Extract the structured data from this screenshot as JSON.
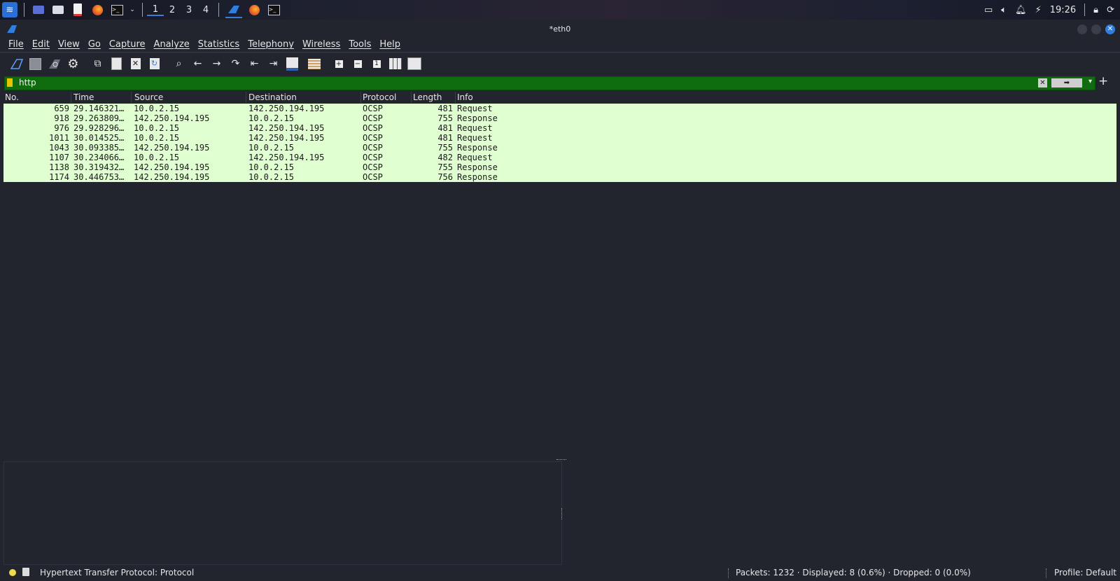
{
  "taskbar": {
    "workspaces": [
      "1",
      "2",
      "3",
      "4"
    ],
    "active_workspace": 0,
    "clock": "19:26"
  },
  "window": {
    "title": "*eth0"
  },
  "menu": [
    "File",
    "Edit",
    "View",
    "Go",
    "Capture",
    "Analyze",
    "Statistics",
    "Telephony",
    "Wireless",
    "Tools",
    "Help"
  ],
  "filter": {
    "value": "http",
    "color": "#0e6b0e"
  },
  "packet_list": {
    "columns": [
      "No.",
      "Time",
      "Source",
      "Destination",
      "Protocol",
      "Length",
      "Info"
    ],
    "row_color": "#e0ffd0",
    "rows": [
      [
        "659",
        "29.146321…",
        "10.0.2.15",
        "142.250.194.195",
        "OCSP",
        "481",
        "Request"
      ],
      [
        "918",
        "29.263809…",
        "142.250.194.195",
        "10.0.2.15",
        "OCSP",
        "755",
        "Response"
      ],
      [
        "976",
        "29.928296…",
        "10.0.2.15",
        "142.250.194.195",
        "OCSP",
        "481",
        "Request"
      ],
      [
        "1011",
        "30.014525…",
        "10.0.2.15",
        "142.250.194.195",
        "OCSP",
        "481",
        "Request"
      ],
      [
        "1043",
        "30.093385…",
        "142.250.194.195",
        "10.0.2.15",
        "OCSP",
        "755",
        "Response"
      ],
      [
        "1107",
        "30.234066…",
        "10.0.2.15",
        "142.250.194.195",
        "OCSP",
        "482",
        "Request"
      ],
      [
        "1138",
        "30.319432…",
        "142.250.194.195",
        "10.0.2.15",
        "OCSP",
        "755",
        "Response"
      ],
      [
        "1174",
        "30.446753…",
        "142.250.194.195",
        "10.0.2.15",
        "OCSP",
        "756",
        "Response"
      ]
    ]
  },
  "status": {
    "field_info": "Hypertext Transfer Protocol: Protocol",
    "packets": "Packets: 1232 · Displayed: 8 (0.6%) · Dropped: 0 (0.0%)",
    "profile": "Profile: Default"
  }
}
